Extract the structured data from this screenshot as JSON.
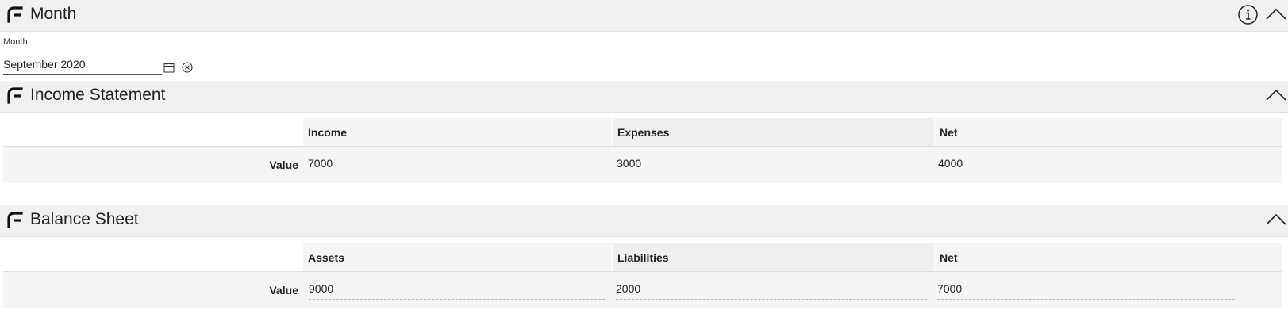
{
  "month_section": {
    "title": "Month",
    "field_label": "Month",
    "field_value": "September 2020",
    "icons": [
      "logo-icon",
      "info-icon",
      "chevron-up-icon",
      "calendar-icon",
      "clear-icon"
    ]
  },
  "income_statement": {
    "title": "Income Statement",
    "columns": [
      "Income",
      "Expenses",
      "Net"
    ],
    "row_label": "Value",
    "values": [
      "7000",
      "3000",
      "4000"
    ]
  },
  "balance_sheet": {
    "title": "Balance Sheet",
    "columns": [
      "Assets",
      "Liabilities",
      "Net"
    ],
    "row_label": "Value",
    "values": [
      "9000",
      "2000",
      "7000"
    ]
  },
  "colors": {
    "header_bg": "#f0f0f0",
    "row_bg": "#f5f5f5",
    "alt_col_bg": "#efefef"
  }
}
